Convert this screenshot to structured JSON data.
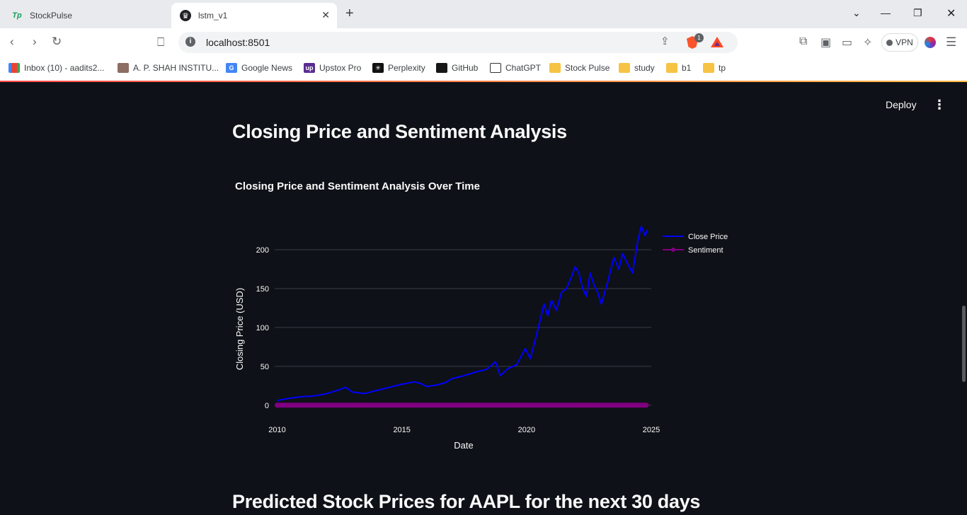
{
  "browser": {
    "tabs": [
      {
        "label": "StockPulse",
        "icon": "tp-logo-icon",
        "active": false
      },
      {
        "label": "lstm_v1",
        "icon": "streamlit-crown-icon",
        "active": true
      }
    ],
    "url": "localhost:8501",
    "vpn_label": "VPN",
    "brave_shield_count": "1",
    "bookmarks": [
      {
        "label": "Inbox (10) - aadits2...",
        "icon": "gmail-icon"
      },
      {
        "label": "A. P. SHAH INSTITU...",
        "icon": "apshah-icon"
      },
      {
        "label": "Google News",
        "icon": "google-news-icon"
      },
      {
        "label": "Upstox Pro",
        "icon": "upstox-icon"
      },
      {
        "label": "Perplexity",
        "icon": "perplexity-icon"
      },
      {
        "label": "GitHub",
        "icon": "github-icon"
      },
      {
        "label": "ChatGPT",
        "icon": "chatgpt-icon"
      },
      {
        "label": "Stock Pulse",
        "icon": "folder-icon"
      },
      {
        "label": "study",
        "icon": "folder-icon"
      },
      {
        "label": "b1",
        "icon": "folder-icon"
      },
      {
        "label": "tp",
        "icon": "folder-icon"
      }
    ]
  },
  "app": {
    "deploy_label": "Deploy",
    "section_title": "Closing Price and Sentiment Analysis",
    "next_section_title": "Predicted Stock Prices for AAPL for the next 30 days"
  },
  "colors": {
    "background": "#0e1117",
    "close_price": "#0000ff",
    "sentiment": "#800080",
    "grid": "#3a3d45"
  },
  "chart_data": {
    "type": "line",
    "title": "Closing Price and Sentiment Analysis Over Time",
    "xlabel": "Date",
    "ylabel": "Closing Price (USD)",
    "xlim": [
      2009.9,
      2025.0
    ],
    "ylim": [
      -12,
      230
    ],
    "x_ticks": [
      2010,
      2015,
      2020,
      2025
    ],
    "y_ticks": [
      0,
      50,
      100,
      150,
      200
    ],
    "grid": true,
    "legend_position": "top-right",
    "series": [
      {
        "name": "Close Price",
        "color": "#0000ff",
        "mode": "lines",
        "x": [
          2010.0,
          2010.5,
          2011.0,
          2011.5,
          2012.0,
          2012.5,
          2012.75,
          2013.0,
          2013.5,
          2014.0,
          2014.5,
          2015.0,
          2015.5,
          2015.75,
          2016.0,
          2016.4,
          2016.75,
          2017.0,
          2017.5,
          2018.0,
          2018.4,
          2018.75,
          2018.95,
          2019.25,
          2019.6,
          2019.95,
          2020.15,
          2020.3,
          2020.55,
          2020.7,
          2020.85,
          2021.0,
          2021.2,
          2021.4,
          2021.6,
          2021.8,
          2021.95,
          2022.1,
          2022.25,
          2022.4,
          2022.55,
          2022.7,
          2022.85,
          2023.0,
          2023.25,
          2023.5,
          2023.7,
          2023.85,
          2024.0,
          2024.25,
          2024.45,
          2024.6,
          2024.75,
          2024.85
        ],
        "y": [
          6,
          9,
          11,
          12,
          15,
          20,
          23,
          17,
          15,
          19,
          23,
          27,
          30,
          28,
          24,
          26,
          29,
          34,
          38,
          43,
          46,
          56,
          38,
          47,
          52,
          73,
          60,
          78,
          110,
          130,
          115,
          135,
          122,
          145,
          150,
          165,
          178,
          170,
          150,
          140,
          170,
          155,
          145,
          130,
          158,
          190,
          175,
          195,
          185,
          170,
          210,
          230,
          218,
          226
        ]
      },
      {
        "name": "Sentiment",
        "color": "#800080",
        "mode": "lines+markers",
        "x_range": [
          2010.0,
          2024.8
        ],
        "value": 0
      }
    ]
  }
}
